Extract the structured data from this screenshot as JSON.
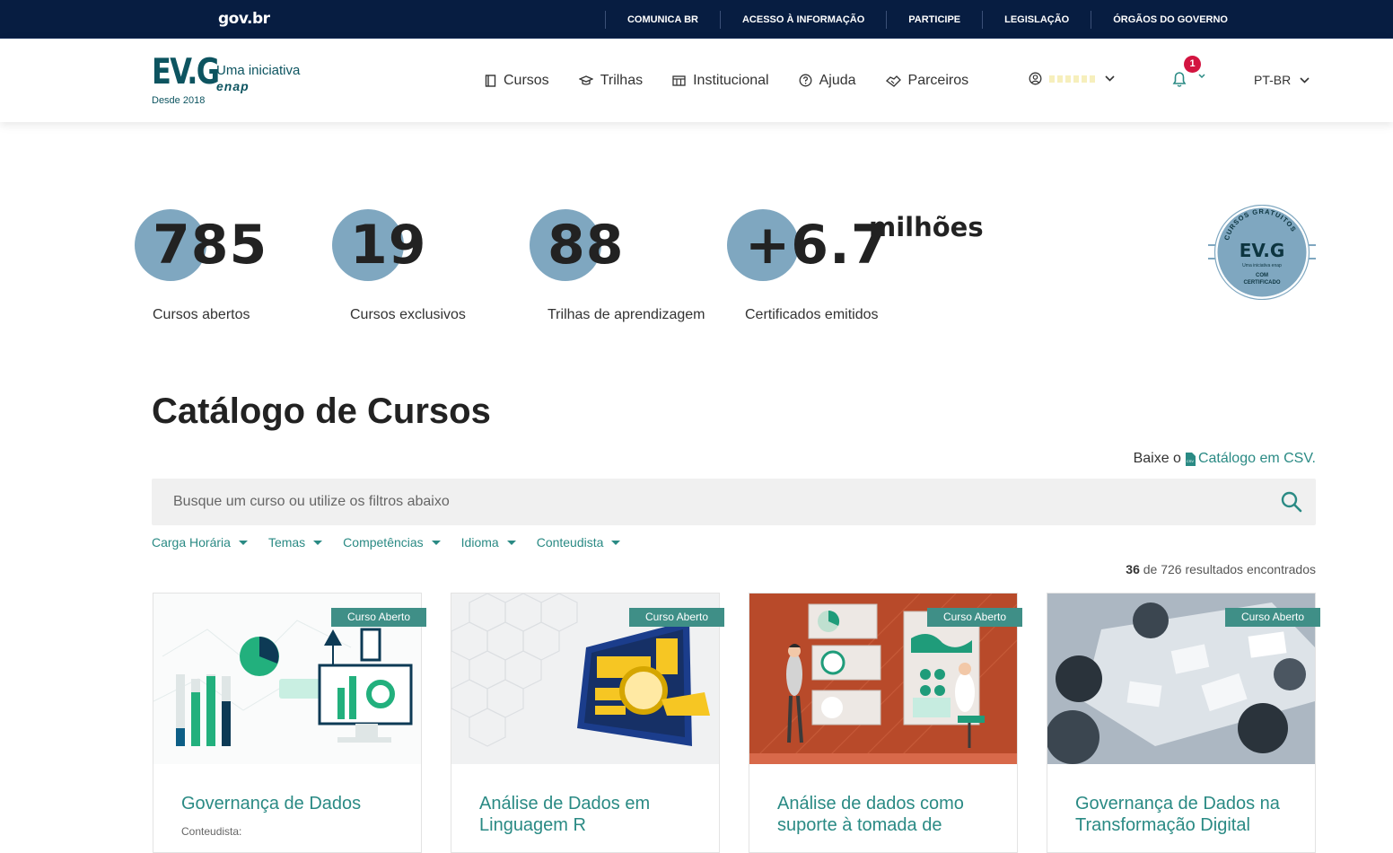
{
  "gov": {
    "logo": "gov.br",
    "links": [
      "COMUNICA BR",
      "ACESSO À INFORMAÇÃO",
      "PARTICIPE",
      "LEGISLAÇÃO",
      "ÓRGÃOS DO GOVERNO"
    ]
  },
  "header": {
    "logo_text": "EV.G",
    "logo_tagline": "Uma iniciativa",
    "logo_enap": "enap",
    "logo_since": "Desde 2018",
    "nav": [
      {
        "label": "Cursos",
        "icon": "book-icon"
      },
      {
        "label": "Trilhas",
        "icon": "graduation-cap-icon"
      },
      {
        "label": "Institucional",
        "icon": "building-icon"
      },
      {
        "label": "Ajuda",
        "icon": "help-circle-icon"
      },
      {
        "label": "Parceiros",
        "icon": "handshake-icon"
      }
    ],
    "notification_count": "1",
    "language": "PT-BR"
  },
  "stats": [
    {
      "value": "785",
      "label": "Cursos abertos"
    },
    {
      "value": "19",
      "label": "Cursos exclusivos"
    },
    {
      "value": "88",
      "label": "Trilhas de aprendizagem"
    },
    {
      "value": "+6.7",
      "label": "Certificados emitidos"
    }
  ],
  "stats_suffix": "milhões",
  "seal": {
    "top_text": "CURSOS GRATUITOS",
    "center": "EV.G",
    "tagline": "Uma iniciativa enap",
    "bottom_1": "COM",
    "bottom_2": "CERTIFICADO"
  },
  "catalog": {
    "title": "Catálogo de Cursos",
    "csv_prefix": "Baixe o",
    "csv_link": "Catálogo em CSV.",
    "search_placeholder": "Busque um curso ou utilize os filtros abaixo",
    "filters": [
      "Carga Horária",
      "Temas",
      "Competências",
      "Idioma",
      "Conteudista"
    ],
    "results_count": "36",
    "results_text": "de 726 resultados encontrados"
  },
  "cards": [
    {
      "badge": "Curso Aberto",
      "title": "Governança de Dados",
      "meta": "Conteudista:"
    },
    {
      "badge": "Curso Aberto",
      "title": "Análise de Dados em Linguagem R",
      "meta": ""
    },
    {
      "badge": "Curso Aberto",
      "title": "Análise de dados como suporte à tomada de",
      "meta": ""
    },
    {
      "badge": "Curso Aberto",
      "title": "Governança de Dados na Transformação Digital",
      "meta": ""
    }
  ],
  "colors": {
    "gov_bar": "#071d41",
    "brand_teal": "#0d5460",
    "link_teal": "#2a8a84",
    "badge": "#3f8f87",
    "stat_circle": "#7fa7c0",
    "notification": "#d31440"
  }
}
